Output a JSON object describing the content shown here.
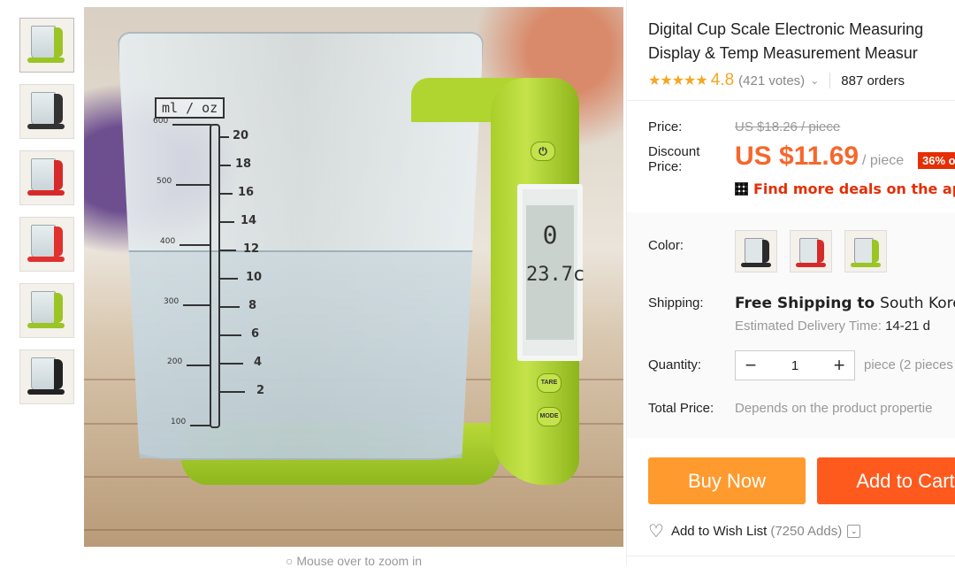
{
  "gallery": {
    "thumbnails": [
      {
        "name": "thumb-green-1",
        "handle_color": "#9bc425"
      },
      {
        "name": "thumb-dark-2",
        "handle_color": "#333333"
      },
      {
        "name": "thumb-red-3",
        "handle_color": "#d62a2a"
      },
      {
        "name": "thumb-red-4",
        "handle_color": "#e0312f"
      },
      {
        "name": "thumb-green-5",
        "handle_color": "#9bc425"
      },
      {
        "name": "thumb-black-6",
        "handle_color": "#222222"
      }
    ],
    "zoom_hint": "Mouse over to zoom in",
    "zoom_icon": "search-icon"
  },
  "product_image": {
    "gauge_unit": "ml / oz",
    "ml_ticks": [
      "600",
      "500",
      "400",
      "300",
      "200",
      "100"
    ],
    "oz_ticks": [
      "20",
      "18",
      "16",
      "14",
      "12",
      "10",
      "8",
      "6",
      "4",
      "2"
    ],
    "lcd_value": "0",
    "lcd_temp": "23.7c",
    "buttons": {
      "tare": "TARE",
      "mode": "MODE"
    }
  },
  "product": {
    "title_line1": "Digital Cup Scale Electronic Measuring",
    "title_line2": "Display & Temp Measurement Measur",
    "stars": "★★★★★",
    "rating": "4.8",
    "votes": "(421 votes)",
    "orders": "887 orders"
  },
  "price": {
    "price_label": "Price:",
    "original": "US $18.26 / piece",
    "discount_label_1": "Discount",
    "discount_label_2": "Price:",
    "discount": "US $11.69",
    "per_piece": "/ piece",
    "badge": "36% o",
    "deals": "Find more deals on the app"
  },
  "options": {
    "color_label": "Color:",
    "swatches": [
      {
        "name": "black",
        "color": "#2b2b2b"
      },
      {
        "name": "red",
        "color": "#d62a2a"
      },
      {
        "name": "green",
        "color": "#9bc425"
      }
    ],
    "shipping_label": "Shipping:",
    "shipping_prefix": "Free Shipping to",
    "shipping_country": "South Kore",
    "delivery_prefix": "Estimated Delivery Time:",
    "delivery_days": "14-21 d",
    "quantity_label": "Quantity:",
    "quantity": "1",
    "minus": "−",
    "plus": "+",
    "quantity_unit": "piece (2 pieces",
    "total_label": "Total Price:",
    "total_value": "Depends on the product propertie"
  },
  "actions": {
    "buy_now": "Buy Now",
    "add_to_cart": "Add to Cart",
    "wish_label": "Add to Wish List",
    "wish_adds": "(7250 Adds)",
    "colors": {
      "buy": "#ff9a2e",
      "cart": "#ff5a1e",
      "accent": "#f5672c",
      "badge": "#e62e04"
    }
  }
}
